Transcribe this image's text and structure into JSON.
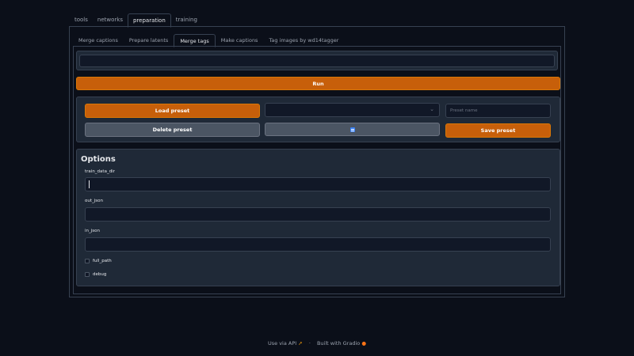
{
  "top_tabs": [
    "tools",
    "networks",
    "preparation",
    "training"
  ],
  "sub_tabs": [
    "Merge captions",
    "Prepare latents",
    "Merge tags",
    "Make captions",
    "Tag images by wd14tagger"
  ],
  "run_label": "Run",
  "preset": {
    "load_label": "Load preset",
    "delete_label": "Delete preset",
    "save_label": "Save preset",
    "name_placeholder": "Preset name",
    "select_value": ""
  },
  "options": {
    "title": "Options",
    "train_data_dir_label": "train_data_dir",
    "out_json_label": "out_json",
    "in_json_label": "in_json",
    "full_path_label": "full_path",
    "debug_label": "debug"
  },
  "footer": {
    "api_label": "Use via API",
    "separator": "·",
    "built_label": "Built with Gradio"
  }
}
